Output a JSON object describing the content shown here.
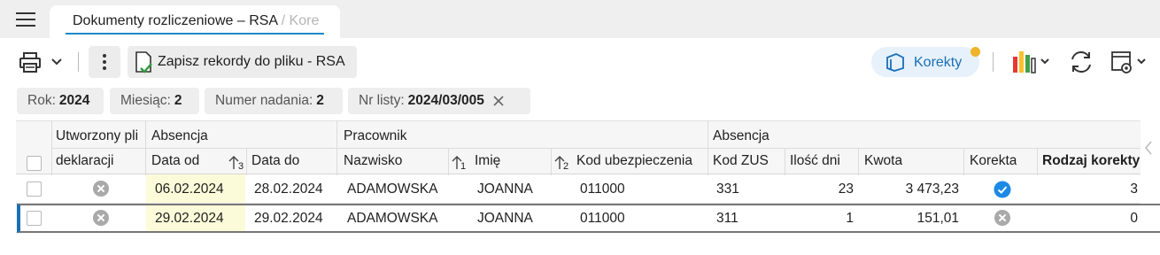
{
  "tab": {
    "title": "Dokumenty rozliczeniowe – RSA",
    "title_rest": " / Kore"
  },
  "toolbar": {
    "save_label": "Zapisz rekordy do pliku - RSA",
    "korekty_label": "Korekty"
  },
  "filters": [
    {
      "label": "Rok:",
      "value": "2024"
    },
    {
      "label": "Miesiąc:",
      "value": "2"
    },
    {
      "label": "Numer nadania:",
      "value": "2"
    },
    {
      "label": "Nr listy:",
      "value": "2024/03/005"
    }
  ],
  "groups": {
    "utworzony": "Utworzony pli",
    "absencja1": "Absencja",
    "pracownik": "Pracownik",
    "absencja2": "Absencja"
  },
  "columns": {
    "deklaracji": "deklaracji",
    "data_od": "Data od",
    "data_od_sort": "3",
    "data_do": "Data do",
    "nazwisko": "Nazwisko",
    "nazwisko_sort": "1",
    "imie": "Imię",
    "imie_sort": "2",
    "kod_ubezp": "Kod ubezpieczenia",
    "kod_zus": "Kod ZUS",
    "ilosc_dni": "Ilość dni",
    "kwota": "Kwota",
    "korekta": "Korekta",
    "rodzaj": "Rodzaj korekty"
  },
  "rows": [
    {
      "data_od": "06.02.2024",
      "data_do": "28.02.2024",
      "nazwisko": "ADAMOWSKA",
      "imie": "JOANNA",
      "kod_ubezp": "011000",
      "kod_zus": "331",
      "ilosc_dni": "23",
      "kwota": "3 473,23",
      "korekta": true,
      "rodzaj": "3"
    },
    {
      "data_od": "29.02.2024",
      "data_do": "29.02.2024",
      "nazwisko": "ADAMOWSKA",
      "imie": "JOANNA",
      "kod_ubezp": "011000",
      "kod_zus": "311",
      "ilosc_dni": "1",
      "kwota": "151,01",
      "korekta": false,
      "rodzaj": "0"
    }
  ],
  "colors": {
    "accent": "#1a6fb5",
    "badge": "#f0b429",
    "highlight": "#fcfbd9"
  }
}
